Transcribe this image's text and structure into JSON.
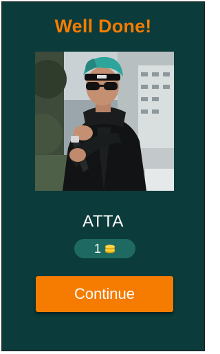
{
  "header": {
    "title": "Well Done!"
  },
  "result": {
    "answer": "ATTA",
    "coins": "1",
    "coin_icon": "coin-stack-icon"
  },
  "actions": {
    "continue_label": "Continue"
  },
  "colors": {
    "background": "#0b3b3a",
    "accent": "#f57c00",
    "pill": "#1e6a62",
    "coin": "#ffd24a"
  }
}
